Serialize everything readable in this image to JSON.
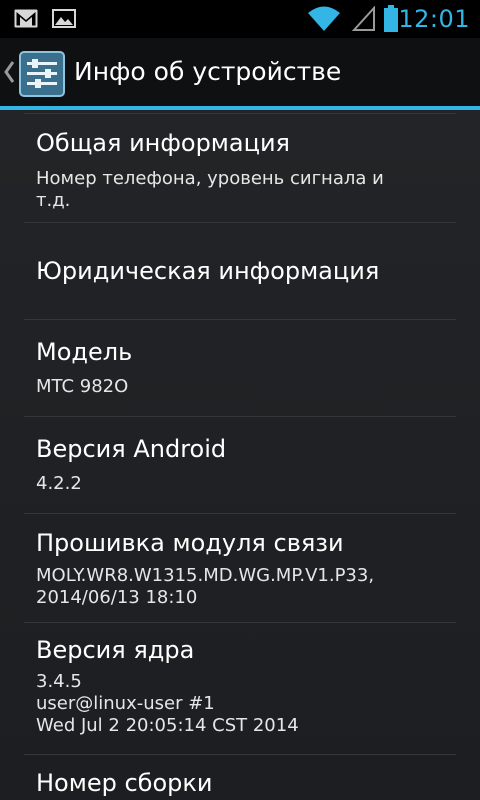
{
  "status_bar": {
    "time": "12:01",
    "notification_icons": [
      "gmail-icon",
      "gallery-icon"
    ],
    "system_icons": [
      "wifi-icon",
      "signal-icon",
      "battery-icon"
    ],
    "accent_color": "#33b5e5"
  },
  "action_bar": {
    "title": "Инфо об устройстве",
    "up_icon": "chevron-left-icon",
    "app_icon": "settings-icon"
  },
  "items": [
    {
      "title": "Общая информация",
      "summary": "Номер телефона, уровень сигнала и\nт.д."
    },
    {
      "title": "Юридическая информация",
      "summary": ""
    },
    {
      "title": "Модель",
      "summary": "MTC 982O"
    },
    {
      "title": "Версия Android",
      "summary": "4.2.2"
    },
    {
      "title": "Прошивка модуля связи",
      "summary": "MOLY.WR8.W1315.MD.WG.MP.V1.P33,\n2014/06/13 18:10"
    },
    {
      "title": "Версия ядра",
      "summary": "3.4.5\nuser@linux-user #1\nWed Jul 2 20:05:14 CST 2014"
    },
    {
      "title": "Номер сборки",
      "summary": ""
    }
  ]
}
